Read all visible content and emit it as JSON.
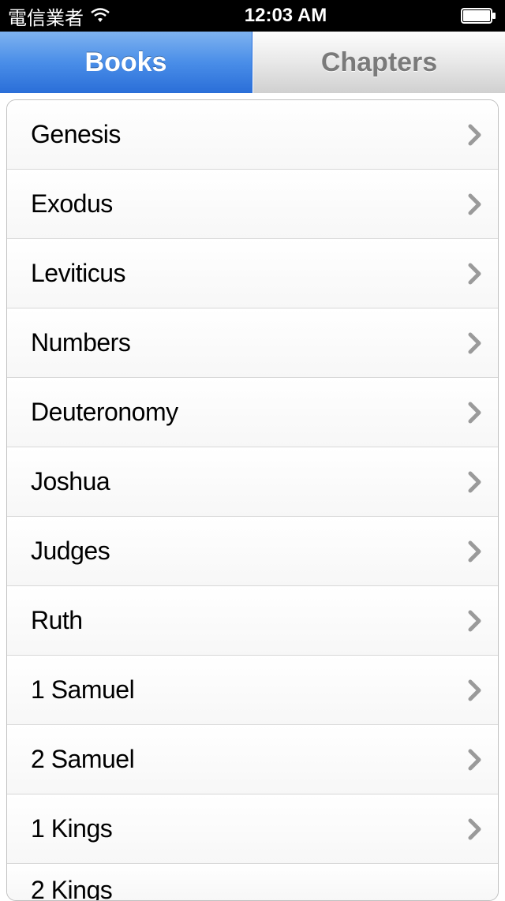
{
  "status": {
    "carrier": "電信業者",
    "time": "12:03 AM"
  },
  "tabs": {
    "books": "Books",
    "chapters": "Chapters"
  },
  "books": [
    {
      "label": "Genesis"
    },
    {
      "label": "Exodus"
    },
    {
      "label": "Leviticus"
    },
    {
      "label": "Numbers"
    },
    {
      "label": "Deuteronomy"
    },
    {
      "label": "Joshua"
    },
    {
      "label": "Judges"
    },
    {
      "label": "Ruth"
    },
    {
      "label": "1 Samuel"
    },
    {
      "label": "2 Samuel"
    },
    {
      "label": "1 Kings"
    },
    {
      "label": "2 Kings"
    }
  ]
}
